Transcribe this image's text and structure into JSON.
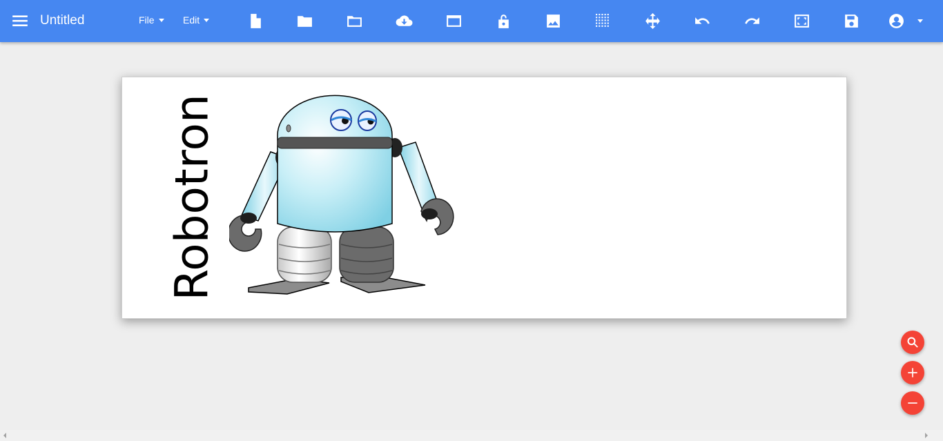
{
  "app": {
    "title": "Untitled"
  },
  "menus": {
    "file": "File",
    "edit": "Edit"
  },
  "toolbar": {
    "tools": [
      "new-file-icon",
      "open-folder-icon",
      "folder-icon",
      "cloud-download-icon",
      "window-icon",
      "unlock-icon",
      "image-icon",
      "grid-icon",
      "move-icon",
      "undo-icon",
      "redo-icon",
      "fit-screen-icon",
      "save-icon",
      "account-icon"
    ]
  },
  "canvas": {
    "label_text": "Robotron"
  },
  "fabs": [
    "zoom-search-icon",
    "zoom-in-icon",
    "zoom-out-icon"
  ],
  "colors": {
    "toolbar": "#4687f1",
    "background": "#eeeeee",
    "fab": "#f44336",
    "robot_body": "#a9e4f0"
  }
}
